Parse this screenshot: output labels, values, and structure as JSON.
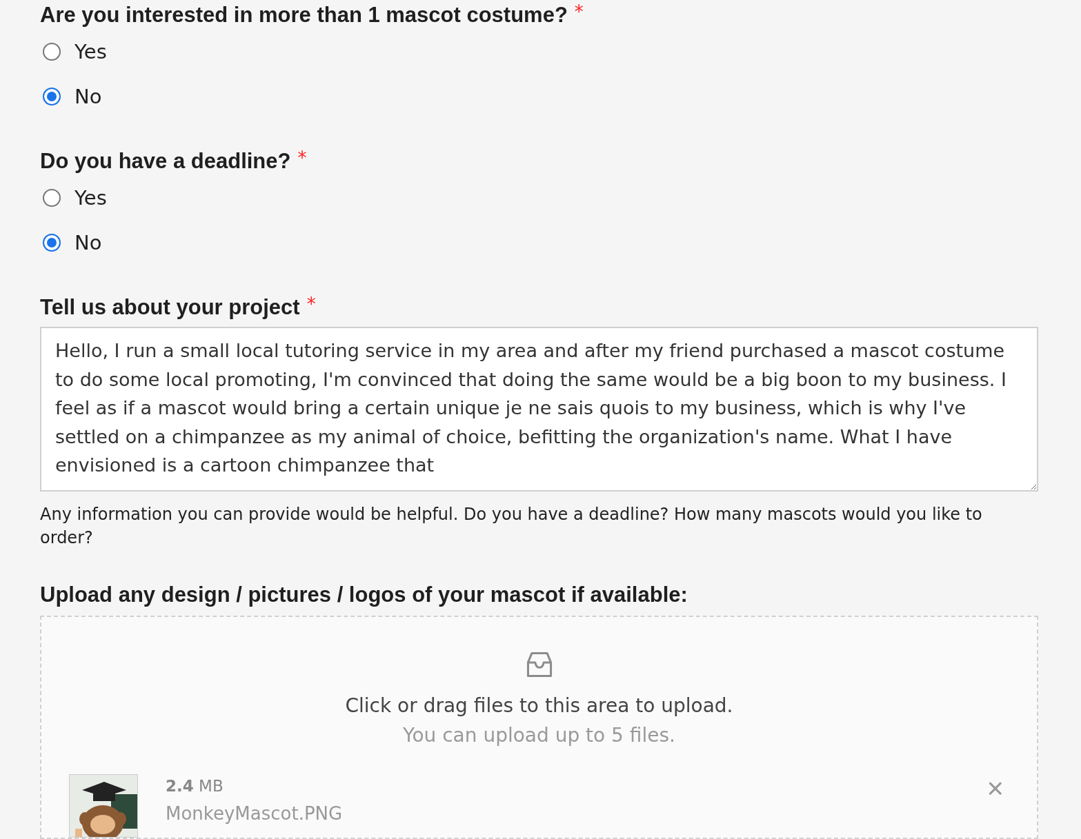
{
  "questions": [
    {
      "label": "Are you interested in more than 1 mascot costume?",
      "required": true,
      "options": [
        {
          "label": "Yes",
          "selected": false
        },
        {
          "label": "No",
          "selected": true
        }
      ]
    },
    {
      "label": "Do you have a deadline?",
      "required": true,
      "options": [
        {
          "label": "Yes",
          "selected": false
        },
        {
          "label": "No",
          "selected": true
        }
      ]
    }
  ],
  "required_mark": "*",
  "project": {
    "label": "Tell us about your project",
    "required": true,
    "value": "Hello, I run a small local tutoring service in my area and after my friend purchased a mascot costume to do some local promoting, I'm convinced that doing the same would be a big boon to my business. I feel as if a mascot would bring a certain unique je ne sais quois to my business, which is why I've settled on a chimpanzee as my animal of choice, befitting the organization's name. What I have envisioned is a cartoon chimpanzee that",
    "help": "Any information you can provide would be helpful. Do you have a deadline? How many mascots would you like to order?"
  },
  "upload": {
    "label": "Upload any design / pictures / logos of your mascot if available:",
    "hint": "Click or drag files to this area to upload.",
    "limit": "You can upload up to 5 files.",
    "files": [
      {
        "kind": "picture",
        "size": "**2.4** MB",
        "name": "MonkeyMascot.PNG",
        "remove": "×"
      }
    ]
  }
}
